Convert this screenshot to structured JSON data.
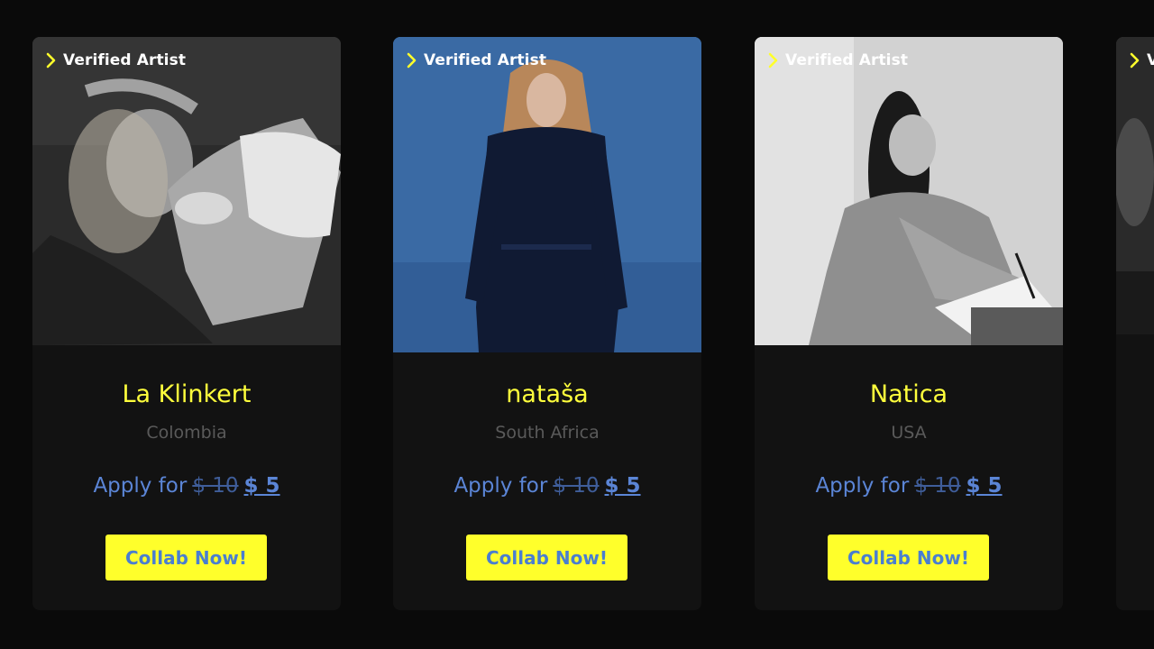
{
  "cards": [
    {
      "badge": "Verified Artist",
      "name": "La Klinkert",
      "country": "Colombia",
      "apply_label": "Apply for",
      "old_price": "$ 10",
      "new_price": "$ 5",
      "button_label": "Collab Now!"
    },
    {
      "badge": "Verified Artist",
      "name": "nataša",
      "country": "South Africa",
      "apply_label": "Apply for",
      "old_price": "$ 10",
      "new_price": "$ 5",
      "button_label": "Collab Now!"
    },
    {
      "badge": "Verified Artist",
      "name": "Natica",
      "country": "USA",
      "apply_label": "Apply for",
      "old_price": "$ 10",
      "new_price": "$ 5",
      "button_label": "Collab Now!"
    },
    {
      "badge": "V"
    }
  ],
  "colors": {
    "background": "#0a0a0a",
    "card": "#121212",
    "name": "#ffff3c",
    "country": "#5a5a5a",
    "price": "#5b85d6",
    "button_bg": "#ffff2b",
    "button_text": "#4a7ed0"
  },
  "icons": {
    "badge_icon": "chevron-right-icon"
  }
}
